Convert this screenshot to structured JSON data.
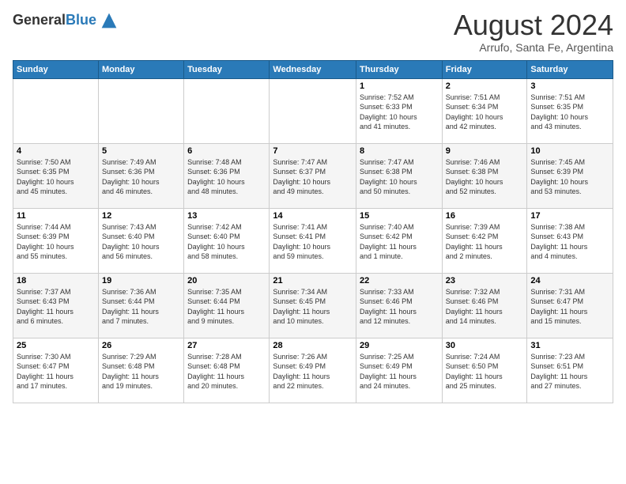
{
  "header": {
    "logo_general": "General",
    "logo_blue": "Blue",
    "month_title": "August 2024",
    "subtitle": "Arrufo, Santa Fe, Argentina"
  },
  "weekdays": [
    "Sunday",
    "Monday",
    "Tuesday",
    "Wednesday",
    "Thursday",
    "Friday",
    "Saturday"
  ],
  "weeks": [
    [
      {
        "day": "",
        "info": ""
      },
      {
        "day": "",
        "info": ""
      },
      {
        "day": "",
        "info": ""
      },
      {
        "day": "",
        "info": ""
      },
      {
        "day": "1",
        "info": "Sunrise: 7:52 AM\nSunset: 6:33 PM\nDaylight: 10 hours\nand 41 minutes."
      },
      {
        "day": "2",
        "info": "Sunrise: 7:51 AM\nSunset: 6:34 PM\nDaylight: 10 hours\nand 42 minutes."
      },
      {
        "day": "3",
        "info": "Sunrise: 7:51 AM\nSunset: 6:35 PM\nDaylight: 10 hours\nand 43 minutes."
      }
    ],
    [
      {
        "day": "4",
        "info": "Sunrise: 7:50 AM\nSunset: 6:35 PM\nDaylight: 10 hours\nand 45 minutes."
      },
      {
        "day": "5",
        "info": "Sunrise: 7:49 AM\nSunset: 6:36 PM\nDaylight: 10 hours\nand 46 minutes."
      },
      {
        "day": "6",
        "info": "Sunrise: 7:48 AM\nSunset: 6:36 PM\nDaylight: 10 hours\nand 48 minutes."
      },
      {
        "day": "7",
        "info": "Sunrise: 7:47 AM\nSunset: 6:37 PM\nDaylight: 10 hours\nand 49 minutes."
      },
      {
        "day": "8",
        "info": "Sunrise: 7:47 AM\nSunset: 6:38 PM\nDaylight: 10 hours\nand 50 minutes."
      },
      {
        "day": "9",
        "info": "Sunrise: 7:46 AM\nSunset: 6:38 PM\nDaylight: 10 hours\nand 52 minutes."
      },
      {
        "day": "10",
        "info": "Sunrise: 7:45 AM\nSunset: 6:39 PM\nDaylight: 10 hours\nand 53 minutes."
      }
    ],
    [
      {
        "day": "11",
        "info": "Sunrise: 7:44 AM\nSunset: 6:39 PM\nDaylight: 10 hours\nand 55 minutes."
      },
      {
        "day": "12",
        "info": "Sunrise: 7:43 AM\nSunset: 6:40 PM\nDaylight: 10 hours\nand 56 minutes."
      },
      {
        "day": "13",
        "info": "Sunrise: 7:42 AM\nSunset: 6:40 PM\nDaylight: 10 hours\nand 58 minutes."
      },
      {
        "day": "14",
        "info": "Sunrise: 7:41 AM\nSunset: 6:41 PM\nDaylight: 10 hours\nand 59 minutes."
      },
      {
        "day": "15",
        "info": "Sunrise: 7:40 AM\nSunset: 6:42 PM\nDaylight: 11 hours\nand 1 minute."
      },
      {
        "day": "16",
        "info": "Sunrise: 7:39 AM\nSunset: 6:42 PM\nDaylight: 11 hours\nand 2 minutes."
      },
      {
        "day": "17",
        "info": "Sunrise: 7:38 AM\nSunset: 6:43 PM\nDaylight: 11 hours\nand 4 minutes."
      }
    ],
    [
      {
        "day": "18",
        "info": "Sunrise: 7:37 AM\nSunset: 6:43 PM\nDaylight: 11 hours\nand 6 minutes."
      },
      {
        "day": "19",
        "info": "Sunrise: 7:36 AM\nSunset: 6:44 PM\nDaylight: 11 hours\nand 7 minutes."
      },
      {
        "day": "20",
        "info": "Sunrise: 7:35 AM\nSunset: 6:44 PM\nDaylight: 11 hours\nand 9 minutes."
      },
      {
        "day": "21",
        "info": "Sunrise: 7:34 AM\nSunset: 6:45 PM\nDaylight: 11 hours\nand 10 minutes."
      },
      {
        "day": "22",
        "info": "Sunrise: 7:33 AM\nSunset: 6:46 PM\nDaylight: 11 hours\nand 12 minutes."
      },
      {
        "day": "23",
        "info": "Sunrise: 7:32 AM\nSunset: 6:46 PM\nDaylight: 11 hours\nand 14 minutes."
      },
      {
        "day": "24",
        "info": "Sunrise: 7:31 AM\nSunset: 6:47 PM\nDaylight: 11 hours\nand 15 minutes."
      }
    ],
    [
      {
        "day": "25",
        "info": "Sunrise: 7:30 AM\nSunset: 6:47 PM\nDaylight: 11 hours\nand 17 minutes."
      },
      {
        "day": "26",
        "info": "Sunrise: 7:29 AM\nSunset: 6:48 PM\nDaylight: 11 hours\nand 19 minutes."
      },
      {
        "day": "27",
        "info": "Sunrise: 7:28 AM\nSunset: 6:48 PM\nDaylight: 11 hours\nand 20 minutes."
      },
      {
        "day": "28",
        "info": "Sunrise: 7:26 AM\nSunset: 6:49 PM\nDaylight: 11 hours\nand 22 minutes."
      },
      {
        "day": "29",
        "info": "Sunrise: 7:25 AM\nSunset: 6:49 PM\nDaylight: 11 hours\nand 24 minutes."
      },
      {
        "day": "30",
        "info": "Sunrise: 7:24 AM\nSunset: 6:50 PM\nDaylight: 11 hours\nand 25 minutes."
      },
      {
        "day": "31",
        "info": "Sunrise: 7:23 AM\nSunset: 6:51 PM\nDaylight: 11 hours\nand 27 minutes."
      }
    ]
  ]
}
